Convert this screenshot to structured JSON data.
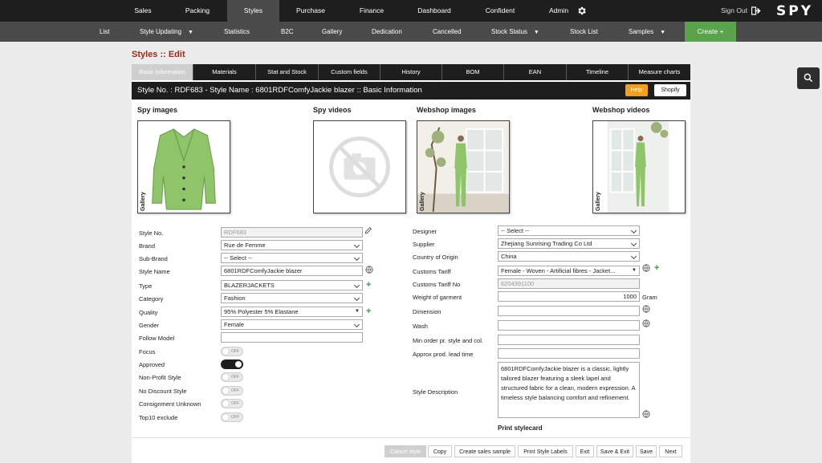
{
  "topnav": {
    "items": [
      "Sales",
      "Packing",
      "Styles",
      "Purchase",
      "Finance",
      "Dashboard",
      "Confident",
      "Admin"
    ],
    "active": "Styles",
    "signout": "Sign Out",
    "logo": "SPY"
  },
  "subnav": {
    "items": [
      "List",
      "Style Updating",
      "Statistics",
      "B2C",
      "Gallery",
      "Dedication",
      "Cancelled",
      "Stock Status",
      "Stock List",
      "Samples"
    ],
    "create": "Create +",
    "create_color": "#5aa34c"
  },
  "page_title": "Styles :: Edit",
  "tabs": [
    "Basic Information",
    "Materials",
    "Stat and Stock",
    "Custom fields",
    "History",
    "BOM",
    "EAN",
    "Timeline",
    "Measure charts"
  ],
  "header": {
    "title": "Style No. : RDF683  -  Style Name : 6801RDFComfyJackie blazer :: Basic Information",
    "help": "Help",
    "shopify": "Shopify"
  },
  "media": {
    "spy_images": "Spy images",
    "spy_videos": "Spy videos",
    "webshop_images": "Webshop images",
    "webshop_videos": "Webshop videos",
    "gallery_label": "Gallery"
  },
  "left_form": {
    "style_no": {
      "label": "Style No.",
      "value": "RDF683"
    },
    "brand": {
      "label": "Brand",
      "value": "Rue de Femme"
    },
    "sub_brand": {
      "label": "Sub-Brand",
      "value": "-- Select --"
    },
    "style_name": {
      "label": "Style Name",
      "value": "6801RDFComfyJackie blazer"
    },
    "type": {
      "label": "Type",
      "value": "BLAZERJACKETS"
    },
    "category": {
      "label": "Category",
      "value": "Fashion"
    },
    "quality": {
      "label": "Quality",
      "value": "95% Polyester 5% Elastane"
    },
    "gender": {
      "label": "Gender",
      "value": "Female"
    },
    "follow_model": {
      "label": "Follow Model",
      "value": ""
    },
    "focus": {
      "label": "Focus",
      "state": "OFF"
    },
    "approved": {
      "label": "Approved",
      "state": "ON"
    },
    "non_profit": {
      "label": "Non-Profit Style",
      "state": "OFF"
    },
    "no_discount": {
      "label": "No Discount Style",
      "state": "OFF"
    },
    "consignment": {
      "label": "Consignment Unknown",
      "state": "OFF"
    },
    "top10": {
      "label": "Top10 exclude",
      "state": "OFF"
    }
  },
  "right_form": {
    "designer": {
      "label": "Designer",
      "value": "-- Select --"
    },
    "supplier": {
      "label": "Supplier",
      "value": "Zhejiang Sunrising Trading Co Ltd"
    },
    "country": {
      "label": "Country of Origin",
      "value": "China"
    },
    "customs_tariff": {
      "label": "Customs Tariff",
      "value": "Female - Woven - Artificial fibres - Jacket..."
    },
    "customs_tariff_no": {
      "label": "Customs Tariff No",
      "value": "6204391100"
    },
    "weight": {
      "label": "Weight of garment",
      "value": "1000",
      "unit": "Gram"
    },
    "dimension": {
      "label": "Dimension",
      "value": ""
    },
    "wash": {
      "label": "Wash",
      "value": ""
    },
    "min_order": {
      "label": "Min order pr. style and col.",
      "value": ""
    },
    "lead_time": {
      "label": "Approx prod. lead time",
      "value": ""
    },
    "description": {
      "label": "Style Description",
      "value": "6801RDFComfyJackie blazer is a classic, lightly tailored blazer featuring a sleek lapel and structured fabric for a clean, modern expression. A timeless style balancing comfort and refinement."
    },
    "print": "Print stylecard"
  },
  "footer": [
    "Cancel style",
    "Copy",
    "Create sales sample",
    "Print Style Labels",
    "Exit",
    "Save & Exit",
    "Save",
    "Next"
  ]
}
